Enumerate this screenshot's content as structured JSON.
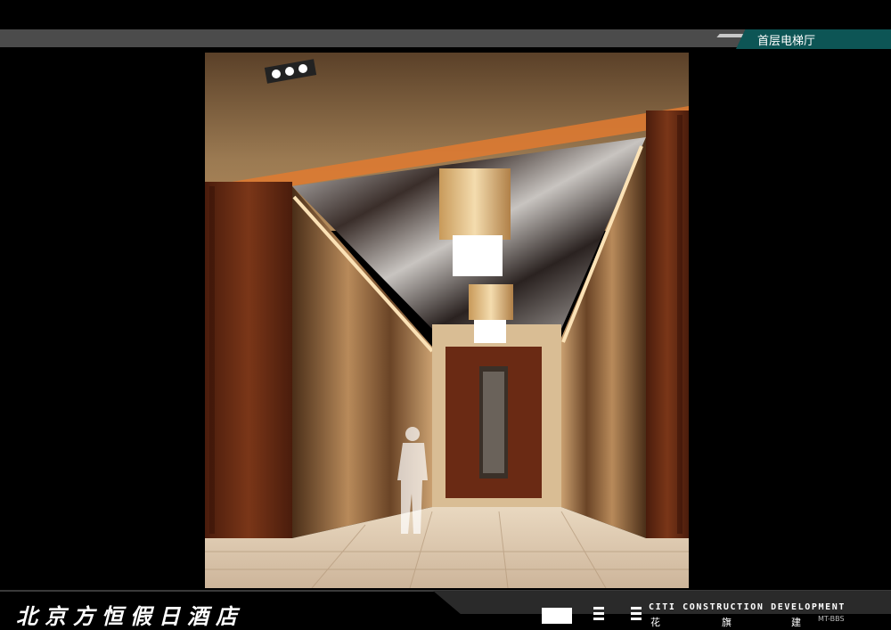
{
  "header": {
    "page_title": "首层电梯厅"
  },
  "footer": {
    "hotel_name": "北京方恒假日酒店",
    "company_en": "CITI CONSTRUCTION DEVELOPMENT",
    "company_cn_1": "花",
    "company_cn_2": "旗",
    "company_cn_3": "建",
    "watermark": "MT-BBS"
  },
  "colors": {
    "title_tab": "#0d5555",
    "top_bar": "#4b4b4b",
    "background": "#000000",
    "wood": "#6a2c14",
    "ceiling": "#8a6a45"
  }
}
